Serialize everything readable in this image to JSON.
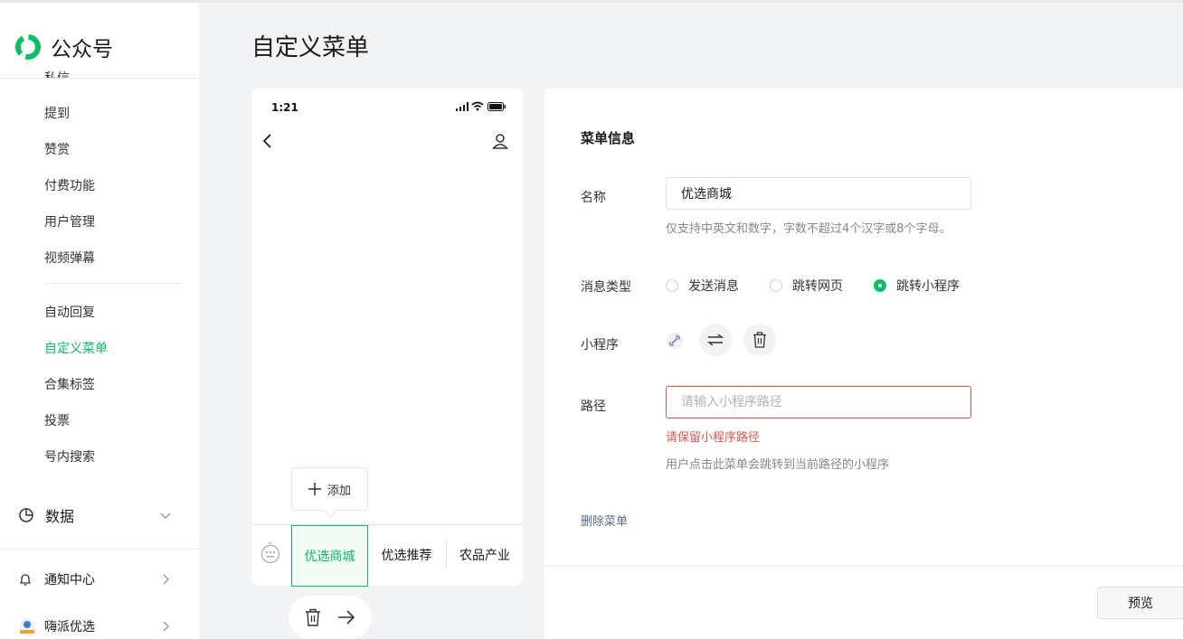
{
  "app": {
    "name": "公众号"
  },
  "colors": {
    "brand": "#07c160",
    "error": "#e5534b",
    "link": "#576b95"
  },
  "sidebar": {
    "items_a": [
      {
        "label": "提到"
      },
      {
        "label": "赞赏"
      },
      {
        "label": "付费功能"
      },
      {
        "label": "用户管理"
      },
      {
        "label": "视频弹幕"
      }
    ],
    "items_b": [
      {
        "label": "自动回复"
      },
      {
        "label": "自定义菜单",
        "active": true
      },
      {
        "label": "合集标签"
      },
      {
        "label": "投票"
      },
      {
        "label": "号内搜索"
      }
    ],
    "data_group": {
      "label": "数据",
      "icon": "pie-chart-icon"
    },
    "notify": {
      "label": "通知中心",
      "icon": "bell-icon"
    },
    "account": {
      "label": "嗨派优选",
      "icon": "account-avatar"
    }
  },
  "page": {
    "title": "自定义菜单"
  },
  "phone": {
    "time": "1:21",
    "add_label": "添加",
    "menu": [
      {
        "label": "优选商城",
        "selected": true
      },
      {
        "label": "优选推荐"
      },
      {
        "label": "农品产业"
      }
    ]
  },
  "form": {
    "section_title": "菜单信息",
    "name_label": "名称",
    "name_value": "优选商城",
    "name_hint": "仅支持中英文和数字，字数不超过4个汉字或8个字母。",
    "type_label": "消息类型",
    "type_options": [
      {
        "label": "发送消息",
        "checked": false
      },
      {
        "label": "跳转网页",
        "checked": false
      },
      {
        "label": "跳转小程序",
        "checked": true
      }
    ],
    "miniprogram_label": "小程序",
    "path_label": "路径",
    "path_placeholder": "请输入小程序路径",
    "path_error": "请保留小程序路径",
    "path_hint": "用户点击此菜单会跳转到当前路径的小程序",
    "delete_label": "删除菜单",
    "preview_label": "预览"
  }
}
